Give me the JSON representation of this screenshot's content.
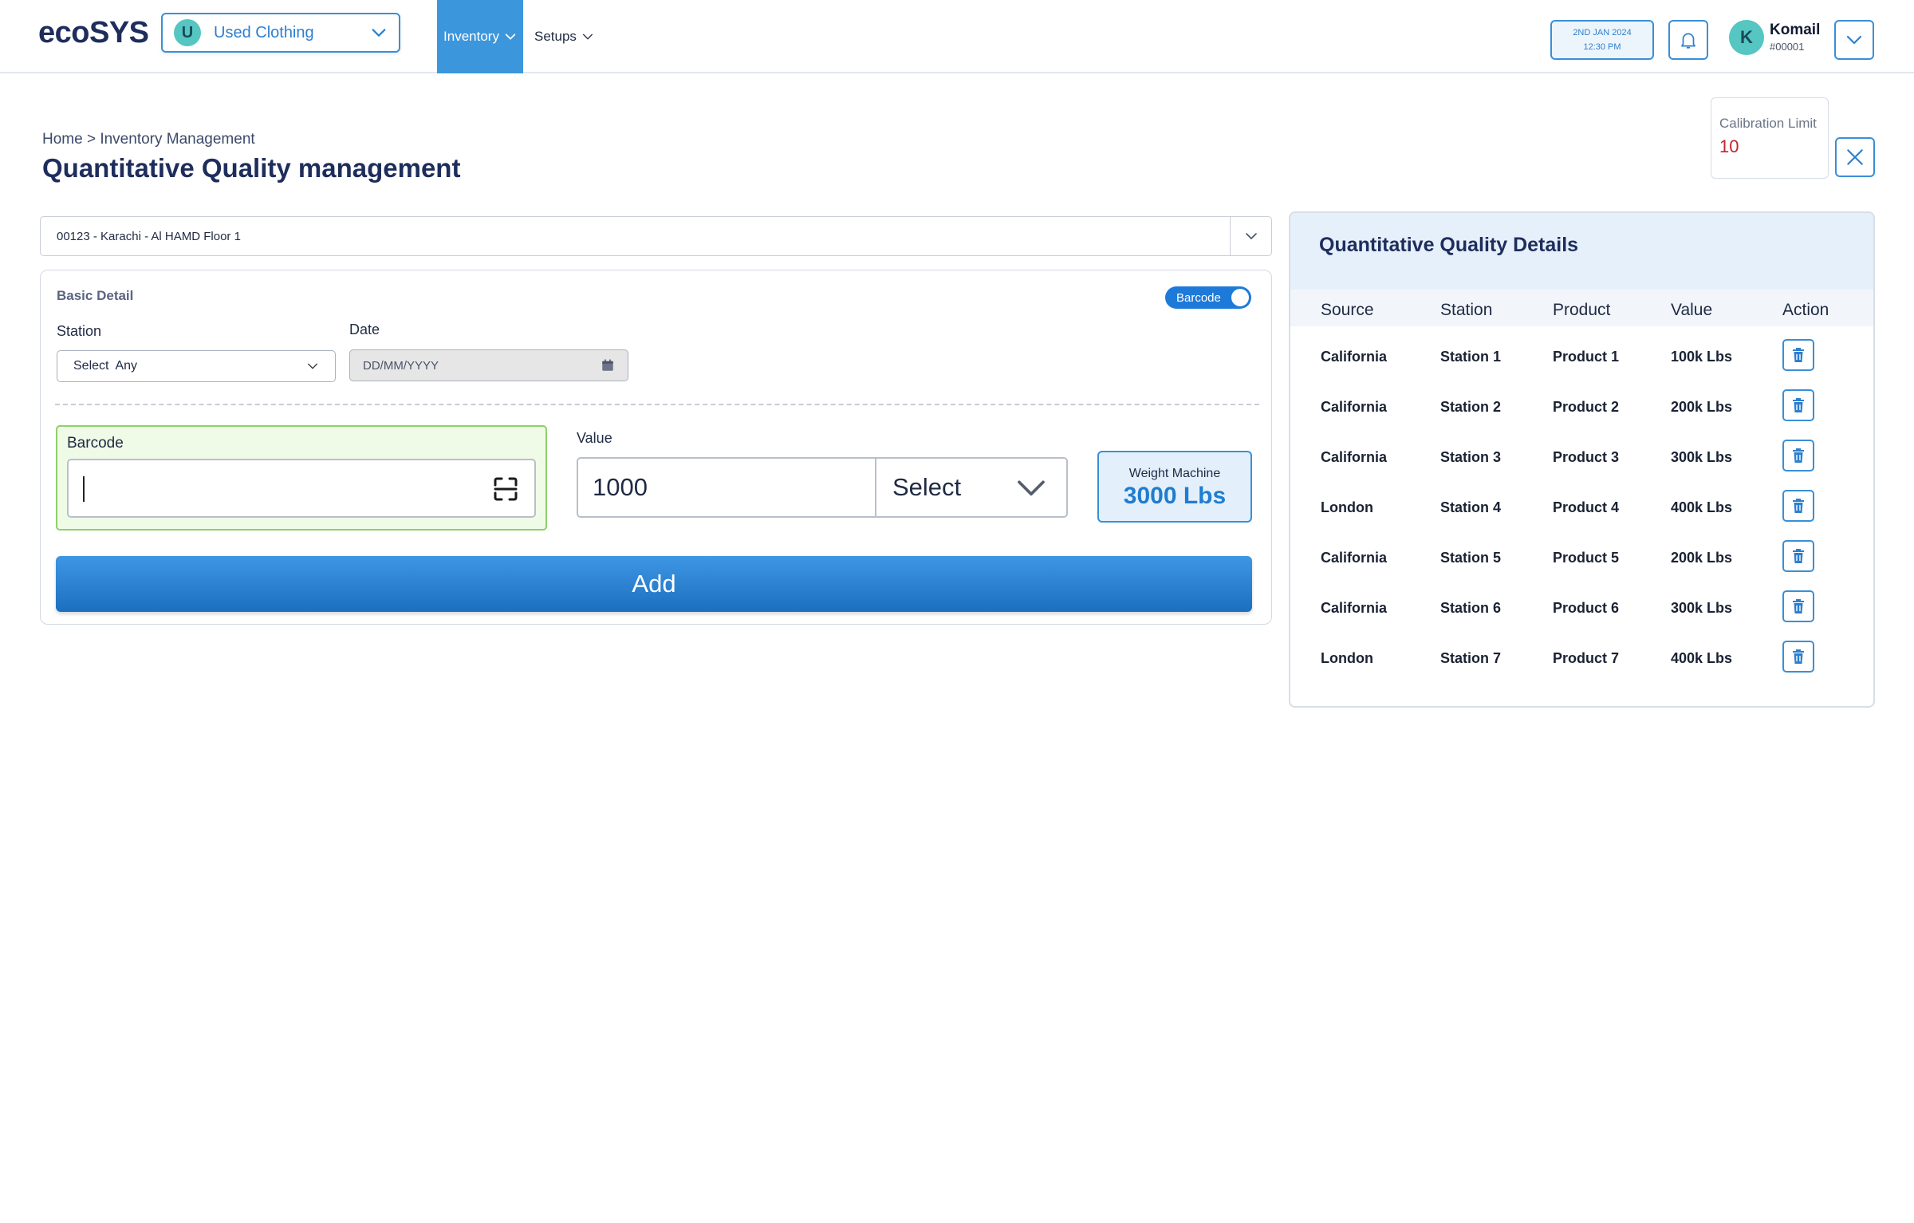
{
  "app": {
    "logo": "ecoSYS"
  },
  "business": {
    "initial": "U",
    "name": "Used Clothing"
  },
  "nav": {
    "inventory": "Inventory",
    "setups": "Setups"
  },
  "datetime": {
    "date": "2ND JAN 2024",
    "time": "12:30 PM"
  },
  "user": {
    "initial": "K",
    "name": "Komail",
    "id": "#00001"
  },
  "breadcrumb": "Home > Inventory Management",
  "page_title": "Quantitative Quality management",
  "calibration": {
    "label": "Calibration Limit",
    "value": "10"
  },
  "warehouse": {
    "value": "00123 - Karachi - Al HAMD Floor 1"
  },
  "form": {
    "section_label": "Basic Detail",
    "toggle_label": "Barcode",
    "station_label": "Station",
    "station_value": "Select  Any",
    "date_label": "Date",
    "date_placeholder": "DD/MM/YYYY",
    "barcode_label": "Barcode",
    "value_label": "Value",
    "value": "1000",
    "unit_select": "Select",
    "weight_label": "Weight Machine",
    "weight_value": "3000 Lbs",
    "add_label": "Add"
  },
  "details": {
    "title": "Quantitative Quality Details",
    "columns": [
      "Source",
      "Station",
      "Product",
      "Value",
      "Action"
    ],
    "rows": [
      {
        "source": "California",
        "station": "Station 1",
        "product": "Product 1",
        "value": "100k Lbs"
      },
      {
        "source": "California",
        "station": "Station 2",
        "product": "Product 2",
        "value": "200k Lbs"
      },
      {
        "source": "California",
        "station": "Station 3",
        "product": "Product 3",
        "value": "300k Lbs"
      },
      {
        "source": "London",
        "station": "Station 4",
        "product": "Product 4",
        "value": "400k Lbs"
      },
      {
        "source": "California",
        "station": "Station 5",
        "product": "Product 5",
        "value": "200k Lbs"
      },
      {
        "source": "California",
        "station": "Station 6",
        "product": "Product 6",
        "value": "300k Lbs"
      },
      {
        "source": "London",
        "station": "Station 7",
        "product": "Product 7",
        "value": "400k Lbs"
      }
    ]
  },
  "colors": {
    "accent": "#3a8fd6",
    "primary_button": "#1e7ad8",
    "success_bg": "#effbe7",
    "danger": "#c4242e"
  }
}
